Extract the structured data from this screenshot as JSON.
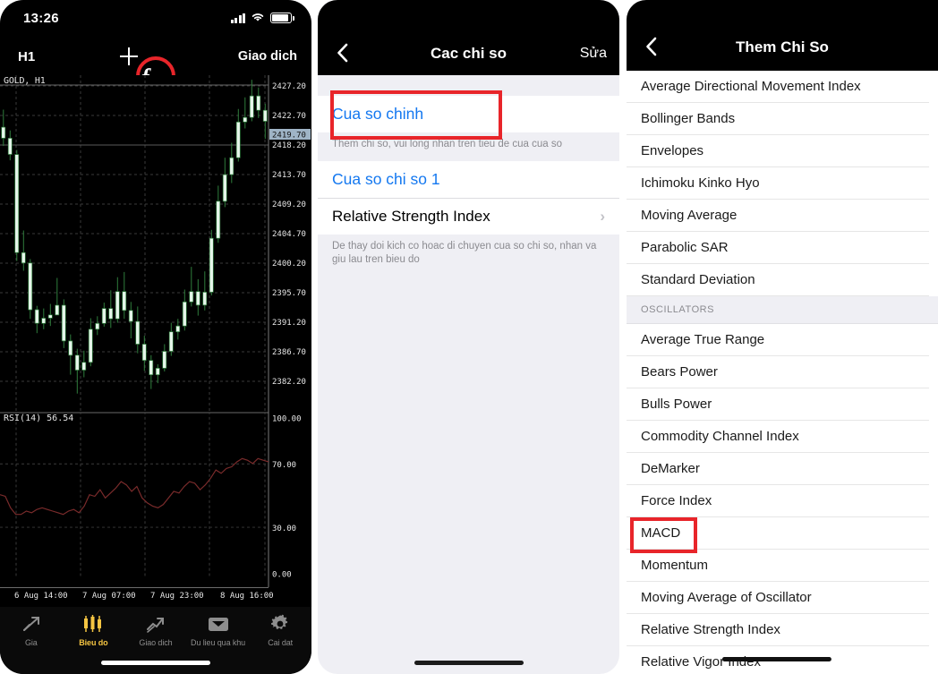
{
  "panel1": {
    "status": {
      "time": "13:26",
      "signal_icon": "cellular-signal-icon",
      "wifi_icon": "wifi-icon",
      "battery_icon": "battery-icon"
    },
    "toolbar": {
      "timeframe": "H1",
      "add_label": "crosshair-icon",
      "indicators_label": "f",
      "objects_label": "objects-icon",
      "trade_label": "Giao dich"
    },
    "chart": {
      "symbol_label": "GOLD, H1",
      "rsi_label": "RSI(14) 56.54",
      "current_price": "2419.70"
    },
    "tabs": [
      {
        "label": "Gia",
        "icon": "quotes-arrow-icon",
        "active": false
      },
      {
        "label": "Bieu do",
        "icon": "candlestick-icon",
        "active": true
      },
      {
        "label": "Giao dich",
        "icon": "trade-arrow-icon",
        "active": false
      },
      {
        "label": "Du lieu qua khu",
        "icon": "inbox-icon",
        "active": false
      },
      {
        "label": "Cai dat",
        "icon": "gear-icon",
        "active": false
      }
    ]
  },
  "panel2": {
    "nav": {
      "back_icon": "chevron-left-icon",
      "title": "Cac chi so",
      "action": "Sửa"
    },
    "main_window": {
      "label": "Cua so chinh",
      "footnote": "Them chi so, vui long nhan tren tieu de cua cua so"
    },
    "indicator_window": {
      "label": "Cua so chi so 1",
      "items": [
        {
          "label": "Relative Strength Index",
          "chevron": "chevron-right-icon"
        }
      ],
      "footnote": "De thay doi kich co hoac di chuyen cua so chi so, nhan va giu lau tren bieu do"
    },
    "highlight_color": "#e8252a"
  },
  "panel3": {
    "nav": {
      "back_icon": "chevron-left-icon",
      "title": "Them Chi So"
    },
    "trend_items": [
      "Average Directional Movement Index",
      "Bollinger Bands",
      "Envelopes",
      "Ichimoku Kinko Hyo",
      "Moving Average",
      "Parabolic SAR",
      "Standard Deviation"
    ],
    "oscillators_header": "OSCILLATORS",
    "oscillator_items": [
      "Average True Range",
      "Bears Power",
      "Bulls Power",
      "Commodity Channel Index",
      "DeMarker",
      "Force Index",
      "MACD",
      "Momentum",
      "Moving Average of Oscillator",
      "Relative Strength Index",
      "Relative Vigor Index"
    ],
    "highlighted_item": "MACD",
    "highlight_color": "#e8252a"
  },
  "chart_data": {
    "type": "line",
    "title": "GOLD, H1",
    "panes": [
      {
        "name": "price",
        "type": "candlestick",
        "ylabel": "Price",
        "ylim": [
          2377.7,
          2429.5
        ],
        "y_ticks": [
          "2427.20",
          "2422.70",
          "2418.20",
          "2413.70",
          "2409.20",
          "2404.70",
          "2400.20",
          "2395.70",
          "2391.20",
          "2386.70",
          "2382.20"
        ],
        "current_price_label": "2419.70",
        "candles": [
          {
            "o": 2421.5,
            "h": 2424.2,
            "c": 2419.8,
            "l": 2418.6
          },
          {
            "o": 2419.8,
            "h": 2421.0,
            "c": 2417.3,
            "l": 2416.4
          },
          {
            "o": 2417.3,
            "h": 2418.0,
            "c": 2402.2,
            "l": 2400.9
          },
          {
            "o": 2402.2,
            "h": 2405.6,
            "c": 2400.6,
            "l": 2399.4
          },
          {
            "o": 2400.6,
            "h": 2401.2,
            "c": 2393.4,
            "l": 2392.0
          },
          {
            "o": 2393.4,
            "h": 2394.0,
            "c": 2391.3,
            "l": 2389.8
          },
          {
            "o": 2391.3,
            "h": 2393.6,
            "c": 2392.1,
            "l": 2390.4
          },
          {
            "o": 2392.1,
            "h": 2394.3,
            "c": 2392.6,
            "l": 2390.9
          },
          {
            "o": 2392.6,
            "h": 2398.3,
            "c": 2394.1,
            "l": 2393.0
          },
          {
            "o": 2394.1,
            "h": 2395.0,
            "c": 2388.6,
            "l": 2387.5
          },
          {
            "o": 2388.6,
            "h": 2389.6,
            "c": 2386.4,
            "l": 2383.4
          },
          {
            "o": 2386.4,
            "h": 2387.4,
            "c": 2384.1,
            "l": 2380.5
          },
          {
            "o": 2384.1,
            "h": 2387.1,
            "c": 2385.3,
            "l": 2383.0
          },
          {
            "o": 2385.3,
            "h": 2392.1,
            "c": 2390.4,
            "l": 2384.7
          },
          {
            "o": 2390.4,
            "h": 2392.4,
            "c": 2391.3,
            "l": 2389.5
          },
          {
            "o": 2391.3,
            "h": 2394.5,
            "c": 2393.6,
            "l": 2390.8
          },
          {
            "o": 2393.6,
            "h": 2396.4,
            "c": 2392.0,
            "l": 2390.6
          },
          {
            "o": 2392.0,
            "h": 2398.4,
            "c": 2396.2,
            "l": 2391.4
          },
          {
            "o": 2396.2,
            "h": 2399.2,
            "c": 2393.3,
            "l": 2392.0
          },
          {
            "o": 2393.3,
            "h": 2394.6,
            "c": 2391.6,
            "l": 2389.0
          },
          {
            "o": 2391.6,
            "h": 2393.9,
            "c": 2388.1,
            "l": 2386.7
          },
          {
            "o": 2388.1,
            "h": 2389.4,
            "c": 2385.6,
            "l": 2384.0
          },
          {
            "o": 2385.6,
            "h": 2386.4,
            "c": 2383.4,
            "l": 2381.2
          },
          {
            "o": 2383.4,
            "h": 2385.0,
            "c": 2384.4,
            "l": 2382.1
          },
          {
            "o": 2384.4,
            "h": 2388.1,
            "c": 2387.0,
            "l": 2383.9
          },
          {
            "o": 2387.0,
            "h": 2391.4,
            "c": 2390.0,
            "l": 2386.3
          },
          {
            "o": 2390.0,
            "h": 2392.0,
            "c": 2390.9,
            "l": 2388.8
          },
          {
            "o": 2390.9,
            "h": 2396.5,
            "c": 2394.6,
            "l": 2390.2
          },
          {
            "o": 2394.6,
            "h": 2400.0,
            "c": 2396.2,
            "l": 2393.9
          },
          {
            "o": 2396.2,
            "h": 2398.1,
            "c": 2394.1,
            "l": 2392.5
          },
          {
            "o": 2394.1,
            "h": 2399.3,
            "c": 2396.1,
            "l": 2393.3
          },
          {
            "o": 2396.1,
            "h": 2405.7,
            "c": 2404.4,
            "l": 2395.6
          },
          {
            "o": 2404.4,
            "h": 2412.5,
            "c": 2410.1,
            "l": 2403.7
          },
          {
            "o": 2410.1,
            "h": 2416.8,
            "c": 2414.2,
            "l": 2409.2
          },
          {
            "o": 2414.2,
            "h": 2419.1,
            "c": 2416.8,
            "l": 2412.9
          },
          {
            "o": 2416.8,
            "h": 2424.3,
            "c": 2422.3,
            "l": 2416.2
          },
          {
            "o": 2422.3,
            "h": 2426.1,
            "c": 2423.0,
            "l": 2421.3
          },
          {
            "o": 2423.0,
            "h": 2428.8,
            "c": 2426.3,
            "l": 2422.4
          },
          {
            "o": 2426.3,
            "h": 2427.6,
            "c": 2424.1,
            "l": 2422.9
          },
          {
            "o": 2424.1,
            "h": 2425.1,
            "c": 2422.4,
            "l": 2419.7
          }
        ]
      },
      {
        "name": "rsi",
        "type": "line",
        "label": "RSI(14) 56.54",
        "ylim": [
          0,
          100
        ],
        "y_ticks": [
          "100.00",
          "70.00",
          "30.00",
          "0.00"
        ],
        "levels": [
          70,
          30
        ],
        "values": [
          50,
          49,
          42,
          38,
          38,
          40,
          39,
          41,
          42,
          41,
          40,
          39,
          38,
          40,
          41,
          39,
          43,
          50,
          49,
          53,
          48,
          51,
          54,
          58,
          56,
          52,
          55,
          48,
          45,
          43,
          42,
          44,
          48,
          52,
          51,
          55,
          58,
          57,
          53,
          56,
          60,
          65,
          63,
          66,
          67,
          70,
          72,
          71,
          69,
          72,
          71,
          70
        ]
      }
    ],
    "x_tick_labels": [
      "6 Aug 14:00",
      "7 Aug 07:00",
      "7 Aug 23:00",
      "8 Aug 16:00"
    ]
  }
}
